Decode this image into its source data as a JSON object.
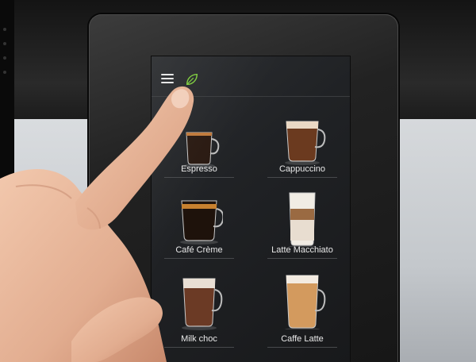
{
  "screen": {
    "menu_icon": "hamburger-menu-icon",
    "eco_icon": "leaf-icon",
    "accent_color": "#7ccb3c",
    "drinks": [
      {
        "label": "Espresso",
        "icon": "espresso-cup-icon"
      },
      {
        "label": "Cappuccino",
        "icon": "cappuccino-cup-icon"
      },
      {
        "label": "Café Crème",
        "icon": "cafe-creme-cup-icon"
      },
      {
        "label": "Latte Macchiato",
        "icon": "latte-macchiato-glass-icon"
      },
      {
        "label": "Milk choc",
        "icon": "milk-chocolate-cup-icon"
      },
      {
        "label": "Caffe Latte",
        "icon": "caffe-latte-glass-icon"
      }
    ]
  }
}
